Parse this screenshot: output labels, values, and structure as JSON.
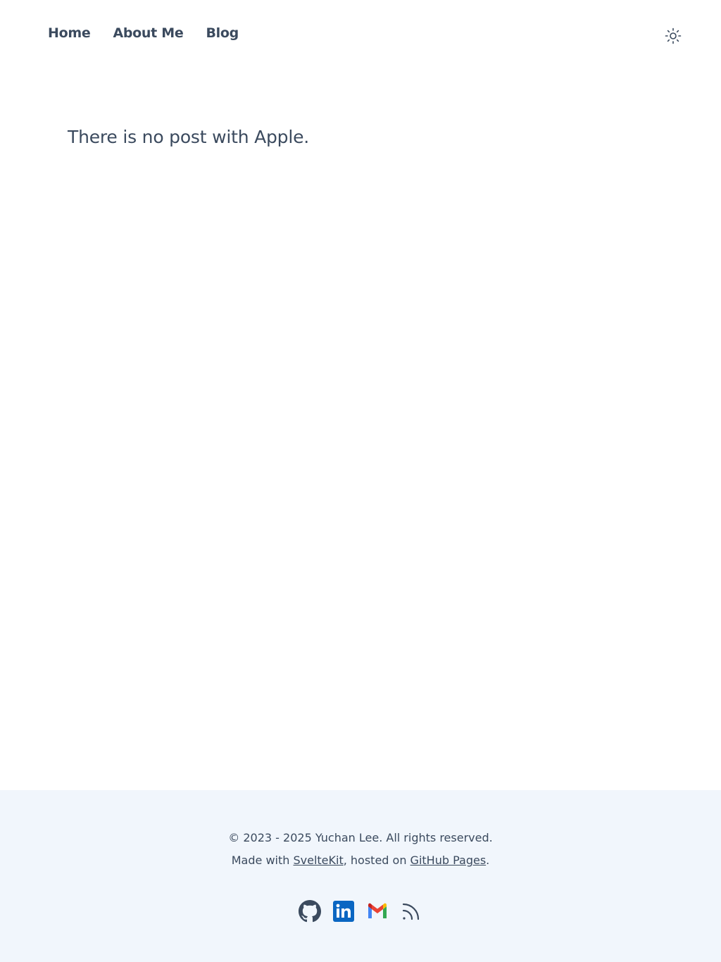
{
  "nav": {
    "items": [
      {
        "label": "Home"
      },
      {
        "label": "About Me"
      },
      {
        "label": "Blog"
      }
    ],
    "theme_icon": "sun-icon"
  },
  "main": {
    "message": "There is no post with Apple."
  },
  "footer": {
    "copyright": "© 2023 - 2025 Yuchan Lee. All rights reserved.",
    "made_with_prefix": "Made with ",
    "sveltekit_link": "SvelteKit",
    "hosted_text": ", hosted on ",
    "github_pages_link": "GitHub Pages",
    "period": ".",
    "socials": [
      {
        "icon": "github-icon"
      },
      {
        "icon": "linkedin-icon"
      },
      {
        "icon": "gmail-icon"
      },
      {
        "icon": "rss-icon"
      }
    ]
  },
  "colors": {
    "text": "#3b4a5e",
    "footer_bg": "#f1f6fc",
    "linkedin": "#0a66c2"
  }
}
